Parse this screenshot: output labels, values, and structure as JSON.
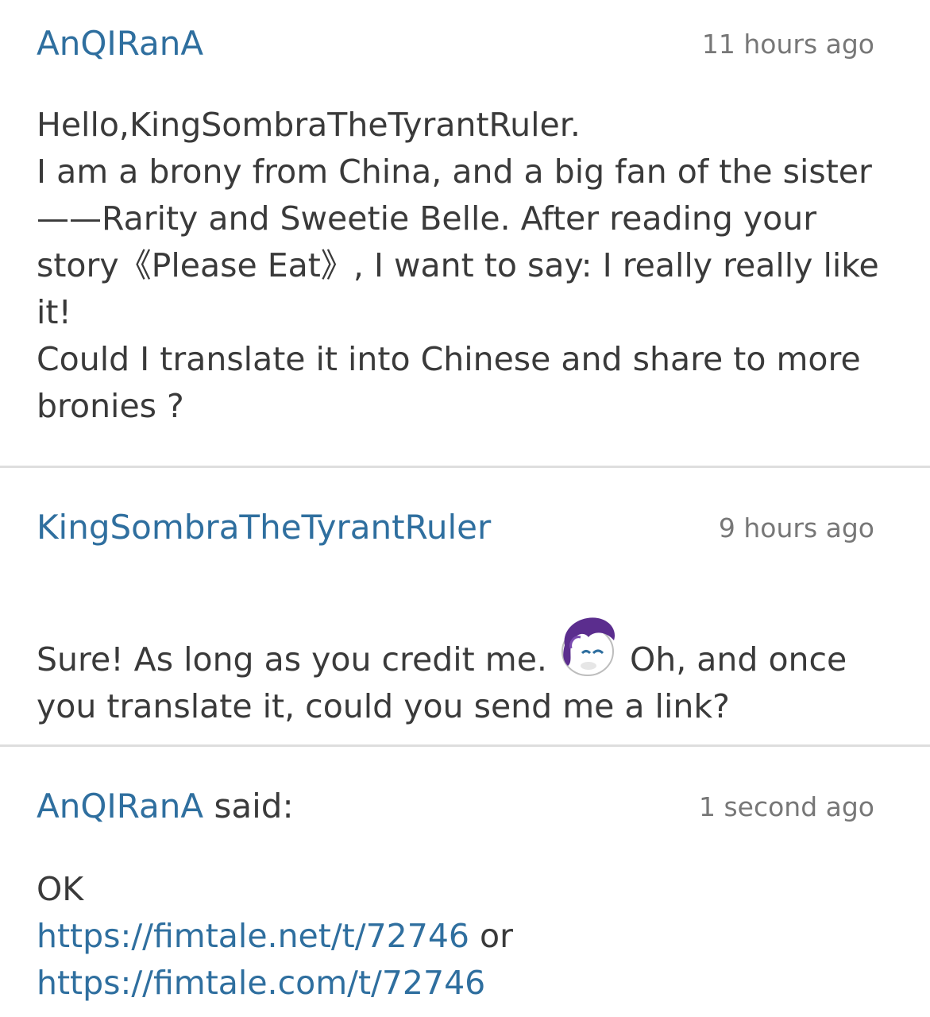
{
  "comments": [
    {
      "author": "AnQIRanA",
      "time": "11 hours ago",
      "lines": [
        "Hello,KingSombraTheTyrantRuler.",
        "I am a brony from China, and a big fan of the sister",
        "——Rarity and Sweetie Belle. After reading your",
        "story《Please Eat》, I want to say: I really really like",
        "it!",
        "Could I translate it into Chinese and share to more",
        "bronies ?"
      ]
    },
    {
      "author": "KingSombraTheTyrantRuler",
      "time": "9 hours ago",
      "line1_before_emoji": "Sure! As long as you credit me.",
      "emoji_icon": "rarity-pony-emoji-icon",
      "line1_after_emoji": "Oh, and once",
      "line2": "you translate it, could you send me a link?"
    },
    {
      "author": "AnQIRanA",
      "said": "said:",
      "time": "1 second ago",
      "line1": "OK",
      "link1": "https://fimtale.net/t/72746",
      "connector": "or",
      "link2": "https://fimtale.com/t/72746"
    }
  ],
  "colors": {
    "author": "#2f6f9f",
    "text": "#3a3a3a",
    "time": "#777777",
    "divider": "#dedede",
    "emoji_mane": "#5b2d8e"
  }
}
